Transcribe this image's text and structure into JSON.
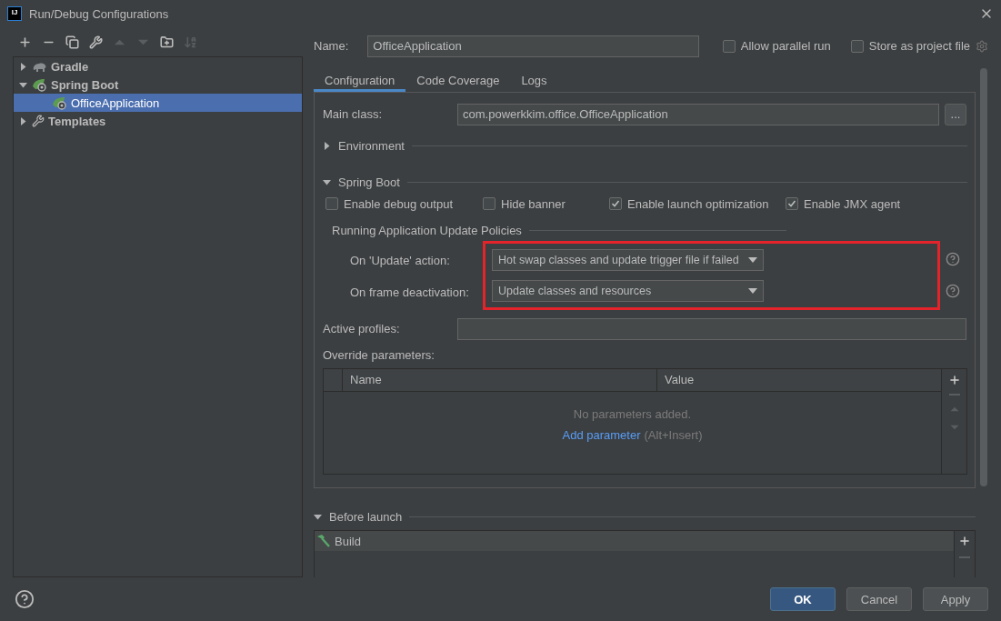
{
  "window": {
    "title": "Run/Debug Configurations",
    "app_icon": "IJ"
  },
  "toolbar": [
    {
      "kind": "add",
      "disabled": false
    },
    {
      "kind": "remove",
      "disabled": false
    },
    {
      "kind": "copy",
      "disabled": false
    },
    {
      "kind": "edit",
      "disabled": false
    },
    {
      "kind": "up",
      "disabled": true
    },
    {
      "kind": "down",
      "disabled": true
    },
    {
      "kind": "folder",
      "disabled": false
    },
    {
      "kind": "sort",
      "disabled": true
    }
  ],
  "tree": [
    {
      "label": "Gradle",
      "kind": "gradle",
      "expanded": false,
      "selected": false
    },
    {
      "label": "Spring Boot",
      "kind": "spring",
      "expanded": true,
      "selected": false,
      "children": [
        {
          "label": "OfficeApplication",
          "kind": "spring",
          "selected": true
        }
      ]
    },
    {
      "label": "Templates",
      "kind": "templates",
      "expanded": false,
      "selected": false
    }
  ],
  "name_field": {
    "label": "Name:",
    "value": "OfficeApplication"
  },
  "header_options": [
    {
      "label": "Allow parallel run",
      "checked": false
    },
    {
      "label": "Store as project file",
      "checked": false
    }
  ],
  "tabs": [
    {
      "label": "Configuration",
      "selected": true
    },
    {
      "label": "Code Coverage",
      "selected": false
    },
    {
      "label": "Logs",
      "selected": false
    }
  ],
  "main_class": {
    "label": "Main class:",
    "value": "com.powerkkim.office.OfficeApplication",
    "button": "..."
  },
  "environment": {
    "title": "Environment",
    "expanded": false
  },
  "spring_boot": {
    "title": "Spring Boot",
    "expanded": true,
    "options": [
      {
        "label": "Enable debug output",
        "checked": false
      },
      {
        "label": "Hide banner",
        "checked": false
      },
      {
        "label": "Enable launch optimization",
        "checked": true
      },
      {
        "label": "Enable JMX agent",
        "checked": true
      }
    ],
    "update_policies": {
      "title": "Running Application Update Policies",
      "highlighted": true,
      "rows": [
        {
          "label": "On 'Update' action:",
          "value": "Hot swap classes and update trigger file if failed"
        },
        {
          "label": "On frame deactivation:",
          "value": "Update classes and resources"
        }
      ]
    }
  },
  "active_profiles": {
    "label": "Active profiles:"
  },
  "override_parameters": {
    "label": "Override parameters:",
    "columns": [
      "Name",
      "Value"
    ],
    "empty_text": "No parameters added.",
    "link": "Add parameter",
    "shortcut": "(Alt+Insert)"
  },
  "before_launch": {
    "title": "Before launch",
    "expanded": true,
    "tasks": [
      {
        "label": "Build",
        "selected": true
      }
    ]
  },
  "buttons": [
    {
      "label": "OK",
      "kind": "primary"
    },
    {
      "label": "Cancel",
      "kind": "normal"
    },
    {
      "label": "Apply",
      "kind": "normal"
    }
  ]
}
